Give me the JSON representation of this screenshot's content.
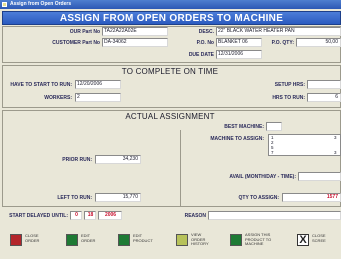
{
  "window": {
    "title": "Assign from Open Orders"
  },
  "banner": {
    "title": "ASSIGN FROM OPEN ORDERS TO MACHINE"
  },
  "header": {
    "our_part_label": "OUR Part No",
    "our_part_value": "TA22A22A02E",
    "customer_part_label": "CUSTOMER Part No",
    "customer_part_value": "DA-34062",
    "desc_label": "DESC.",
    "desc_value": "22\" BLACK WATER HEATER PAN",
    "po_label": "P.O. No",
    "po_value": "BLANKET 06",
    "po_qty_label": "P.O. QTY:",
    "po_qty_value": "50,00",
    "due_date_label": "DUE DATE",
    "due_date_value": "12/31/2006"
  },
  "complete": {
    "title": "TO COMPLETE ON TIME",
    "start_label": "HAVE TO START TO RUN:",
    "start_value": "12/20/2006",
    "workers_label": "WORKERS:",
    "workers_value": "2",
    "setup_label": "SETUP HRS:",
    "setup_value": "",
    "hrs_label": "HRS TO RUN:",
    "hrs_value": "6"
  },
  "actual": {
    "title": "ACTUAL ASSIGNMENT",
    "prior_label": "PRIOR RUN:",
    "prior_value": "34,230",
    "left_label": "LEFT TO RUN:",
    "left_value": "15,770",
    "best_label": "BEST MACHINE:",
    "best_value": "",
    "assign_label": "MACHINE TO ASSIGN:",
    "assign_value": "",
    "machines": [
      {
        "num": "1",
        "val": "3"
      },
      {
        "num": "2",
        "val": ""
      },
      {
        "num": "5",
        "val": ""
      },
      {
        "num": "7",
        "val": "3"
      }
    ],
    "avail_label": "AVAIL (MONTH/DAY - TIME):",
    "avail_value": "",
    "qty_label": "QTY TO ASSIGN:",
    "qty_value": "1577"
  },
  "footer": {
    "delayed_label": "START DELAYED UNTIL:",
    "delayed_month": "0",
    "delayed_day": "18",
    "delayed_year": "2006",
    "reason_label": "REASON",
    "reason_value": ""
  },
  "buttons": [
    {
      "id": "close-order",
      "line1": "CLOSE",
      "line2": "ORDER",
      "line3": "",
      "color": "#b3262b"
    },
    {
      "id": "edit-order",
      "line1": "EDIT",
      "line2": "ORDER",
      "line3": "",
      "color": "#1e7a34"
    },
    {
      "id": "edit-product",
      "line1": "EDIT",
      "line2": "PRODUCT",
      "line3": "",
      "color": "#1e7a34"
    },
    {
      "id": "view-order-history",
      "line1": "VIEW",
      "line2": "ORDER",
      "line3": "HISTORY",
      "color": "#b7c25a"
    },
    {
      "id": "assign-product",
      "line1": "ASSIGN THIS",
      "line2": "PRODUCT TO",
      "line3": "MACHINE",
      "color": "#1e7a34"
    },
    {
      "id": "close-screen",
      "line1": "CLOSE",
      "line2": "SCREE",
      "line3": "",
      "color": "#ffffff",
      "icon": "X"
    }
  ]
}
